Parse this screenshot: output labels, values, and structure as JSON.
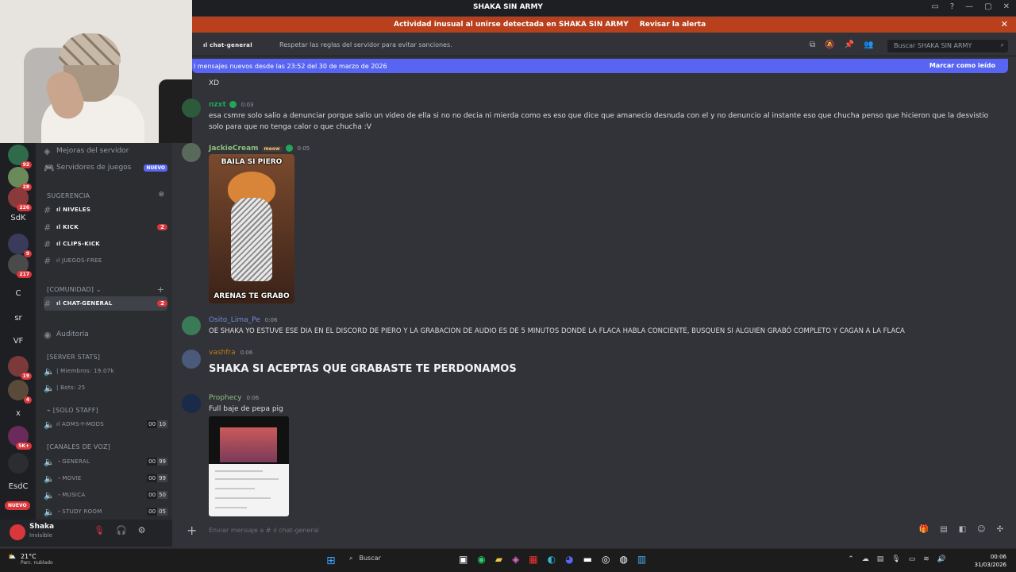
{
  "window": {
    "title": "SHAKA SIN ARMY"
  },
  "alert": {
    "text": "Actividad inusual al unirse detectada en SHAKA SIN ARMY",
    "action": "Revisar la alerta"
  },
  "header": {
    "channel": "ıl chat-general",
    "topic": "Respetar las reglas del servidor para evitar sanciones.",
    "search_placeholder": "Buscar SHAKA SIN ARMY"
  },
  "new_messages": {
    "text": "l mensajes nuevos desde las 23:52 del 30 de marzo de 2026",
    "action": "Marcar como leído"
  },
  "guilds": {
    "items": [
      {
        "label": "",
        "badge": "92"
      },
      {
        "label": "",
        "badge": "28"
      },
      {
        "label": "",
        "badge": "226"
      },
      {
        "label": "SdK",
        "badge": ""
      },
      {
        "label": "",
        "badge": "9"
      },
      {
        "label": "",
        "badge": "217"
      },
      {
        "label": "C",
        "badge": ""
      },
      {
        "label": "sr",
        "badge": ""
      },
      {
        "label": "VF",
        "badge": ""
      },
      {
        "label": "",
        "badge": "19"
      },
      {
        "label": "",
        "badge": "4"
      },
      {
        "label": "x",
        "badge": ""
      },
      {
        "label": "",
        "badge": "5K+"
      },
      {
        "label": "",
        "badge": ""
      },
      {
        "label": "EsdC",
        "badge": ""
      }
    ],
    "new_label": "NUEVO"
  },
  "sidebar": {
    "boosts": "Mejoras del servidor",
    "game_servers": "Servidores de juegos",
    "game_servers_tag": "NUEVO",
    "suggestion_cat": "Sugerencia",
    "suggested": [
      {
        "name": "ıl NIVELES",
        "count": ""
      },
      {
        "name": "ıl KICK",
        "count": "2"
      },
      {
        "name": "ıl CLIPS-KICK",
        "count": ""
      },
      {
        "name": "ıl JUEGOS-FREE",
        "count": ""
      }
    ],
    "community_cat": "[COMUNIDAD]",
    "chat_general": "ıl CHAT-GENERAL",
    "chat_general_count": "2",
    "audit": "Auditoría",
    "stats_cat": "[SERVER STATS]",
    "members": "| Miembros: 19.07k",
    "bots": "| Bots: 25",
    "staff_cat": "[SOLO STAFF]",
    "adms": "ıl ADMS-Y-MODS",
    "adms_count": [
      "00",
      "10"
    ],
    "voice_cat": "[CANALES DE VOZ]",
    "voice": [
      {
        "name": "・GENERAL",
        "a": "00",
        "b": "99"
      },
      {
        "name": "・MOVIE",
        "a": "00",
        "b": "99"
      },
      {
        "name": "・MUSICA",
        "a": "00",
        "b": "50"
      },
      {
        "name": "・STUDY ROOM",
        "a": "00",
        "b": "05"
      }
    ]
  },
  "user": {
    "name": "Shaka",
    "status": "Invisible"
  },
  "messages": [
    {
      "text": "XD"
    },
    {
      "author": "nzxt",
      "time": "0:03",
      "color": "#23a559",
      "text": "esa csmre solo salio a denunciar porque salio un video de ella si no no decia ni mierda como es eso que dice que amanecio desnuda con el y no denuncio al instante eso que chucha penso que hicieron que la desvistio solo para que no tenga calor o que chucha :V"
    },
    {
      "author": "JackieCream",
      "tag": "meow",
      "time": "0:05",
      "color": "#8ec07c",
      "gif_top": "BAILA SI PIERO",
      "gif_bottom": "ARENAS TE GRABO"
    },
    {
      "author": "Osito_Lima_Pe",
      "time": "0:06",
      "color": "#7289da",
      "text": "OE SHAKA YO ESTUVE ESE DIA EN EL DISCORD DE PIERO Y LA GRABACION DE AUDIO ES DE 5 MINUTOS DONDE LA FLACA HABLA CONCIENTE, BUSQUEN SI ALGUIEN GRABÓ COMPLETO Y CAGAN A LA FLACA"
    },
    {
      "author": "vashfra",
      "time": "0:06",
      "color": "#c27c0e",
      "text": "SHAKA SI ACEPTAS QUE GRABASTE TE PERDONAMOS"
    },
    {
      "author": "Prophecy",
      "time": "0:06",
      "color": "#8ec07c",
      "text": "Full baje de pepa pig"
    }
  ],
  "composer": {
    "placeholder": "Enviar mensaje a #",
    "channel": "ıl chat-general"
  },
  "taskbar": {
    "temp": "21°C",
    "condition": "Parc. nublado",
    "search": "Buscar",
    "time": "00:06",
    "date": "31/03/2026"
  }
}
